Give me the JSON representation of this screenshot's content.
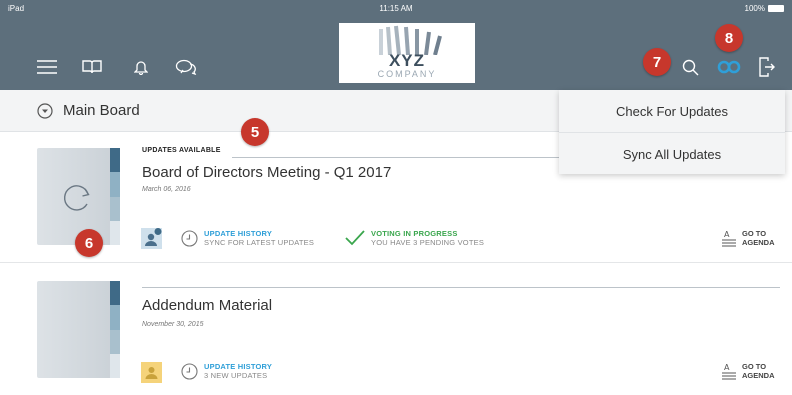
{
  "status_bar": {
    "carrier": "iPad",
    "time": "11:15 AM",
    "battery": "100%"
  },
  "logo": {
    "name": "XYZ",
    "sub": "COMPANY"
  },
  "sub_header": {
    "board": "Main Board"
  },
  "dropdown": {
    "items": [
      "Check For Updates",
      "Sync All Updates"
    ]
  },
  "markers": {
    "m5": "5",
    "m6": "6",
    "m7": "7",
    "m8": "8"
  },
  "documents": [
    {
      "updates_label": "UPDATES AVAILABLE",
      "title": "Board of Directors Meeting - Q1 2017",
      "date": "March 06, 2016",
      "history_title": "UPDATE HISTORY",
      "history_sub": "SYNC FOR LATEST UPDATES",
      "voting_title": "VOTING IN PROGRESS",
      "voting_sub": "YOU HAVE 3 PENDING VOTES",
      "goto": "GO TO AGENDA"
    },
    {
      "title": "Addendum Material",
      "date": "November 30, 2015",
      "history_title": "UPDATE HISTORY",
      "history_sub": "3 NEW UPDATES",
      "goto": "GO TO AGENDA"
    }
  ],
  "colors": {
    "header": "#5d6f7c",
    "accent": "#2f9fd8",
    "voting": "#3aa64d",
    "marker": "#c7372c",
    "book_spine": [
      "#3f6a87",
      "#8fb1c4",
      "#a9c0cd",
      "#dfe6eb"
    ]
  },
  "icons": [
    "menu-icon",
    "book-icon",
    "bell-icon",
    "chat-icon",
    "search-icon",
    "sync-icon",
    "logout-icon",
    "dropdown-circle-icon",
    "refresh-icon",
    "clock-icon",
    "check-icon",
    "agenda-icon"
  ]
}
